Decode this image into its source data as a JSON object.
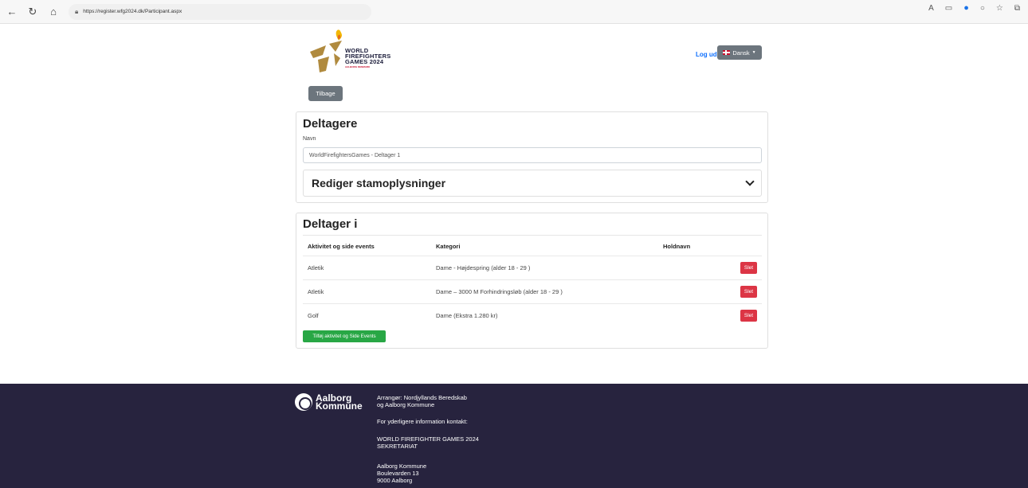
{
  "browser": {
    "url": "https://register.wfg2024.dk/Participant.aspx"
  },
  "header": {
    "logo_line1": "WORLD",
    "logo_line2": "FIREFIGHTERS",
    "logo_line3": "GAMES 2024",
    "logo_sub": "AALBORG DENMARK",
    "logout_label": "Log ud",
    "language_label": "Dansk",
    "back_label": "Tilbage"
  },
  "participants": {
    "title": "Deltagere",
    "name_label": "Navn",
    "name_value": "WorldFirefightersGames - Deltager 1",
    "accordion_title": "Rediger stamoplysninger"
  },
  "participates_in": {
    "title": "Deltager i",
    "columns": [
      "Aktivitet og side events",
      "Kategori",
      "Holdnavn"
    ],
    "rows": [
      {
        "activity": "Atletik",
        "category": "Dame - Højdespring (alder 18 - 29 )",
        "team": "",
        "delete_label": "Slet"
      },
      {
        "activity": "Atletik",
        "category": "Dame – 3000 M Forhindringsløb (alder 18 - 29 )",
        "team": "",
        "delete_label": "Slet"
      },
      {
        "activity": "Golf",
        "category": "Dame (Ekstra 1.280 kr)",
        "team": "",
        "delete_label": "Slet"
      }
    ],
    "add_label": "Tilføj aktivitet og Side Events"
  },
  "footer": {
    "org_logo_line1": "Aalborg",
    "org_logo_line2": "Kommune",
    "organizer_line1": "Arrangør: Nordjyllands Beredskab",
    "organizer_line2": "og Aalborg Kommune",
    "contact_intro": "For yderligere information kontakt:",
    "secretariat_line1": "WORLD FIREFIGHTER GAMES 2024",
    "secretariat_line2": "SEKRETARIAT",
    "address_line1": "Aalborg Kommune",
    "address_line2": "Boulevarden 13",
    "address_line3": "9000 Aalborg"
  },
  "colors": {
    "primary_link": "#0d6efd",
    "secondary_button": "#6c757d",
    "danger": "#dc3545",
    "success": "#28a745",
    "footer_bg": "#27233e",
    "logo_gold": "#b08a3e",
    "logo_red": "#c8102e"
  }
}
